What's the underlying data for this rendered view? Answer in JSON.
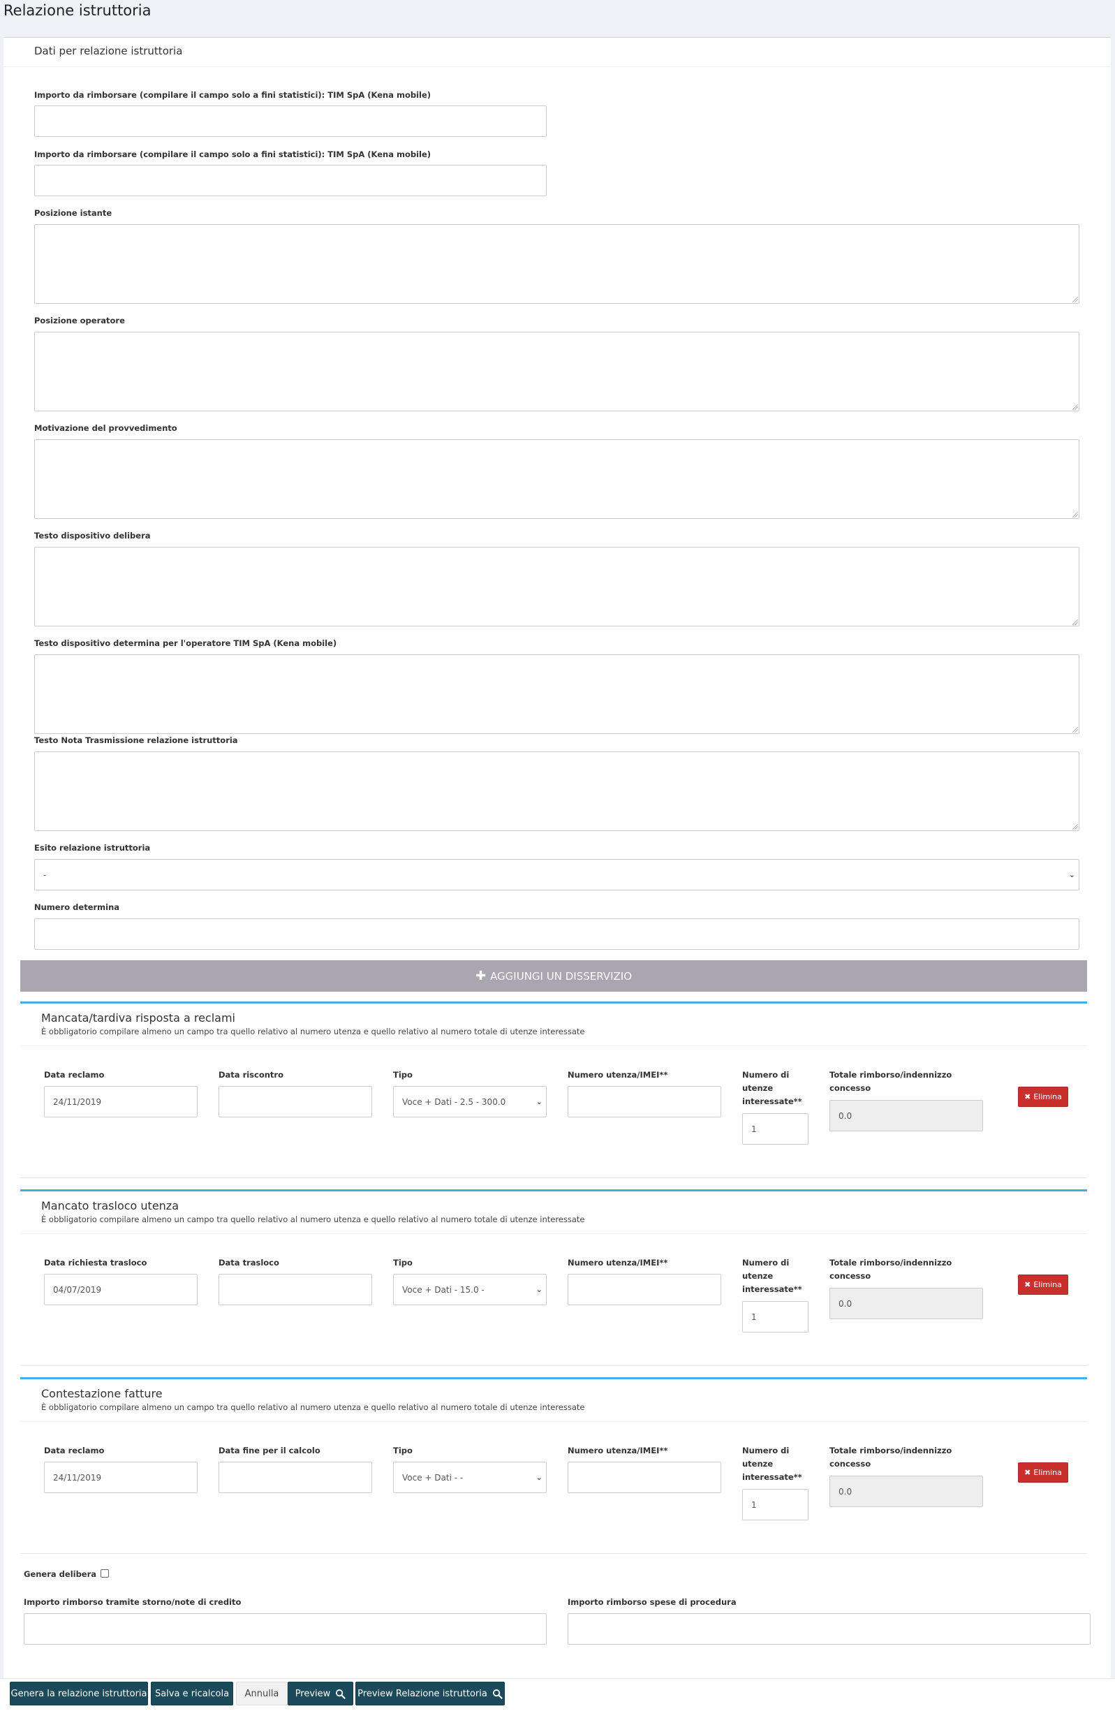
{
  "page_title": "Relazione istruttoria",
  "card_title": "Dati per relazione istruttoria",
  "fields": {
    "importo1_label": "Importo da rimborsare (compilare il campo solo a fini statistici): TIM SpA (Kena mobile)",
    "importo2_label": "Importo da rimborsare (compilare il campo solo a fini statistici): TIM SpA (Kena mobile)",
    "posizione_istante_label": "Posizione istante",
    "posizione_operatore_label": "Posizione operatore",
    "motivazione_label": "Motivazione del provvedimento",
    "testo_delibera_label": "Testo dispositivo delibera",
    "testo_determina_label": "Testo dispositivo determina per l'operatore TIM SpA (Kena mobile)",
    "testo_nota_label": "Testo Nota Trasmissione relazione istruttoria",
    "esito_label": "Esito relazione istruttoria",
    "esito_value": "-",
    "numero_determina_label": "Numero determina"
  },
  "add_button_label": "AGGIUNGI UN DISSERVIZIO",
  "sections": [
    {
      "title": "Mancata/tardiva risposta a reclami",
      "note": "È obbligatorio compilare almeno un campo tra quello relativo al numero utenza e quello relativo al numero totale di utenze interessate",
      "col1_label": "Data reclamo",
      "col1_value": "24/11/2019",
      "col2_label": "Data riscontro",
      "col2_value": "",
      "tipo_label": "Tipo",
      "tipo_value": "Voce + Dati - 2.5 - 300.0",
      "numero_label": "Numero utenza/IMEI**",
      "utenze_label": "Numero di utenze interessate**",
      "utenze_value": "1",
      "totale_label": "Totale rimborso/indennizzo concesso",
      "totale_value": "0.0",
      "delete_label": "Elimina"
    },
    {
      "title": "Mancato trasloco utenza",
      "note": "È obbligatorio compilare almeno un campo tra quello relativo al numero utenza e quello relativo al numero totale di utenze interessate",
      "col1_label": "Data richiesta trasloco",
      "col1_value": "04/07/2019",
      "col2_label": "Data trasloco",
      "col2_value": "",
      "tipo_label": "Tipo",
      "tipo_value": "Voce + Dati - 15.0 -",
      "numero_label": "Numero utenza/IMEI**",
      "utenze_label": "Numero di utenze interessate**",
      "utenze_value": "1",
      "totale_label": "Totale rimborso/indennizzo concesso",
      "totale_value": "0.0",
      "delete_label": "Elimina"
    },
    {
      "title": "Contestazione fatture",
      "note": "È obbligatorio compilare almeno un campo tra quello relativo al numero utenza e quello relativo al numero totale di utenze interessate",
      "col1_label": "Data reclamo",
      "col1_value": "24/11/2019",
      "col2_label": "Data fine per il calcolo",
      "col2_value": "",
      "tipo_label": "Tipo",
      "tipo_value": "Voce + Dati - -",
      "numero_label": "Numero utenza/IMEI**",
      "utenze_label": "Numero di utenze interessate**",
      "utenze_value": "1",
      "totale_label": "Totale rimborso/indennizzo concesso",
      "totale_value": "0.0",
      "delete_label": "Elimina"
    }
  ],
  "genera_delibera_label": "Genera delibera",
  "storno_label": "Importo rimborso tramite storno/note di credito",
  "spese_label": "Importo rimborso spese di procedura",
  "footer": {
    "genera": "Genera la relazione istruttoria",
    "salva": "Salva e ricalcola",
    "annulla": "Annulla",
    "preview": "Preview",
    "preview_relazione": "Preview Relazione istruttoria"
  },
  "colors": {
    "accent_line": "#3fb0e4",
    "add_button": "#a9a6b1",
    "delete_button": "#c9302c",
    "footer_button": "#1b4a5a"
  }
}
